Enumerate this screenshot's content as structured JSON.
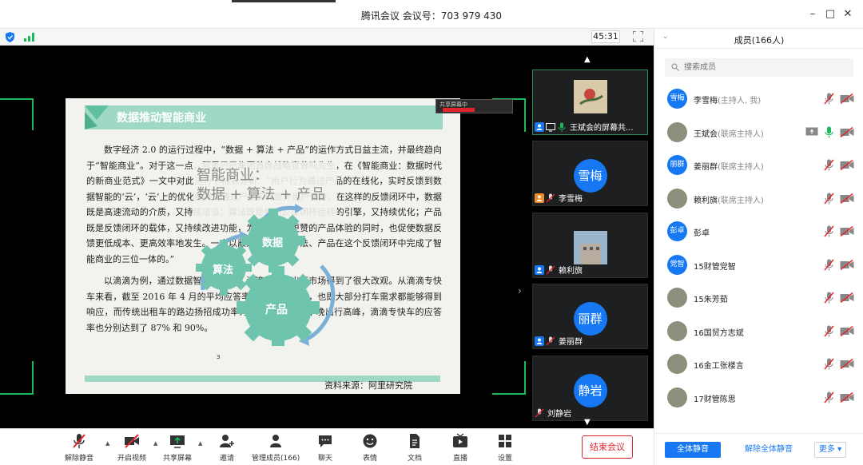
{
  "window": {
    "title": "腾讯会议 会议号：703 979 430",
    "minimize": "–",
    "maximize": "□",
    "close": "✕"
  },
  "status_bar": {
    "timer": "45:31"
  },
  "shared_document": {
    "heading": "数据推动智能商业",
    "paragraph_1": "数字经济 2.0 的运行过程中，“数据 + 算法 + 产品”的运作方式日益主流，并最终趋向于“智能商业”。对于这一点，阿里巴巴集团首席战略官曾鸣先生，在《智能商业：数据时代的新商业范式》一文中对此进行了精彩分析：“用户行为通过产品的在线化，实时反馈到数据智能的‘云’，‘云’上的优化结果又通过产品实时提升用户体验。在这样的反馈闭环中，数据既是高速流动的介质，又持续增值；算法既是推动反馈闭环运转的引擎，又持续优化；产品既是反馈闭环的载体，又持续改进功能，为用户提供更赞的产品体验的同时，也促使数据反馈更低成本、更高效率地发生。一言以蔽之，数据、算法、产品在这个反馈闭环中完成了智能商业的三位一体的。”",
    "paragraph_2": "以滴滴为例，通过数据智能的应用，滴滴专车在出行市场得到了很大改观。从滴滴专快车来看，截至 2016 年 4 月的平均应答率已经高达 90%，也即大部分打车需求都能够得到响应，而传统出租车的路边扬招成功率为 60%。即使在早晚出行高峰，滴滴专快车的应答率也分别达到了 87% 和 90%。",
    "footnote": "3",
    "source": "资料来源：阿里研究院",
    "overlay_title_line1": "智能商业：",
    "overlay_title_line2": "数据 + 算法 + 产品",
    "gear_algorithm": "算法",
    "gear_data": "数据",
    "gear_product": "产品",
    "mini_toolbar_text": "共享屏幕中"
  },
  "video_tiles": [
    {
      "name": "王斌会的屏幕共...",
      "avatar": "",
      "type": "photo"
    },
    {
      "name": "李雪梅",
      "avatar": "雪梅",
      "type": "text"
    },
    {
      "name": "赖利旗",
      "avatar": "",
      "type": "photo"
    },
    {
      "name": "姜丽群",
      "avatar": "丽群",
      "type": "text"
    },
    {
      "name": "刘静岩",
      "avatar": "静岩",
      "type": "text"
    }
  ],
  "members_panel": {
    "title": "成员(166人)",
    "search_placeholder": "搜索成员",
    "members": [
      {
        "avatar": "雪梅",
        "name": "李雪梅",
        "role": "(主持人, 我)",
        "photo": false
      },
      {
        "avatar": "",
        "name": "王斌会",
        "role": "(联席主持人)",
        "photo": true
      },
      {
        "avatar": "丽群",
        "name": "姜丽群",
        "role": "(联席主持人)",
        "photo": false
      },
      {
        "avatar": "",
        "name": "赖利旗",
        "role": "(联席主持人)",
        "photo": true
      },
      {
        "avatar": "彭卓",
        "name": "彭卓",
        "role": "",
        "photo": false
      },
      {
        "avatar": "党智",
        "name": "15财管党智",
        "role": "",
        "photo": false
      },
      {
        "avatar": "",
        "name": "15朱芳茹",
        "role": "",
        "photo": true
      },
      {
        "avatar": "",
        "name": "16国贸方志斌",
        "role": "",
        "photo": true
      },
      {
        "avatar": "",
        "name": "16金工张楼言",
        "role": "",
        "photo": true
      },
      {
        "avatar": "",
        "name": "17财管陈思",
        "role": "",
        "photo": true
      }
    ],
    "mute_all": "全体静音",
    "unmute_all": "解除全体静音",
    "more": "更多"
  },
  "toolbar": {
    "unmute": "解除静音",
    "start_video": "开启视频",
    "share_screen": "共享屏幕",
    "invite": "邀请",
    "manage_members": "管理成员(166)",
    "chat": "聊天",
    "reactions": "表情",
    "documents": "文档",
    "live": "直播",
    "settings": "设置",
    "end_meeting": "结束会议"
  },
  "colors": {
    "accent": "#1678f2",
    "danger": "#e0262c",
    "share_frame": "#1bb85c",
    "gear": "#6fc4ad"
  }
}
